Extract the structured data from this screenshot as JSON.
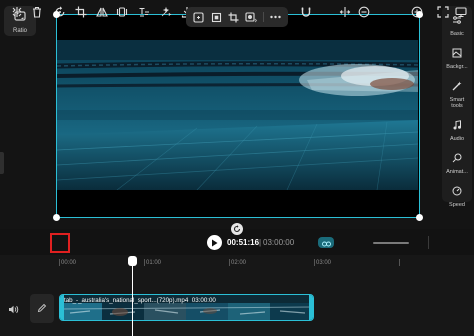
{
  "preview": {
    "ratio_label": "Ratio"
  },
  "right_panel": {
    "items": [
      {
        "label": "Basic",
        "icon": "sliders-icon"
      },
      {
        "label": "Backgr...",
        "icon": "background-icon"
      },
      {
        "label": "Smart tools",
        "icon": "magic-wand-icon"
      },
      {
        "label": "Audio",
        "icon": "music-note-icon"
      },
      {
        "label": "Animat...",
        "icon": "animation-icon"
      },
      {
        "label": "Speed",
        "icon": "speedometer-icon"
      }
    ]
  },
  "playback": {
    "current_time": "00:51:16",
    "separator": "|",
    "total_time": "03:00:00"
  },
  "timeline": {
    "ruler": [
      "00:00",
      "01:00",
      "02:00",
      "03:00"
    ],
    "clip": {
      "title": "tab_-_australia's_national_sport...(720p).mp4",
      "duration": "03:00:00"
    }
  },
  "colors": {
    "accent": "#2bbfd6",
    "highlight": "#e02020",
    "background": "#121212"
  }
}
